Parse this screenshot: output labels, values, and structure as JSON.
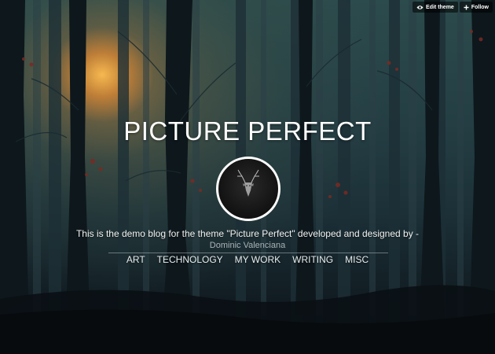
{
  "controls": {
    "edit_theme_label": "Edit theme",
    "follow_label": "Follow",
    "edit_icon": "eye-icon",
    "follow_icon": "plus-icon"
  },
  "header": {
    "title": "PICTURE PERFECT",
    "avatar": "deer-avatar",
    "description": "This is the demo blog for the theme \"Picture Perfect\" developed and designed by -",
    "author": "Dominic Valenciana"
  },
  "nav": {
    "items": [
      "ART",
      "TECHNOLOGY",
      "MY WORK",
      "WRITING",
      "MISC"
    ]
  },
  "colors": {
    "sunlight": "#f0a040",
    "forest": "#243e44",
    "text": "#ffffff",
    "author_link": "#a9b3b8"
  }
}
